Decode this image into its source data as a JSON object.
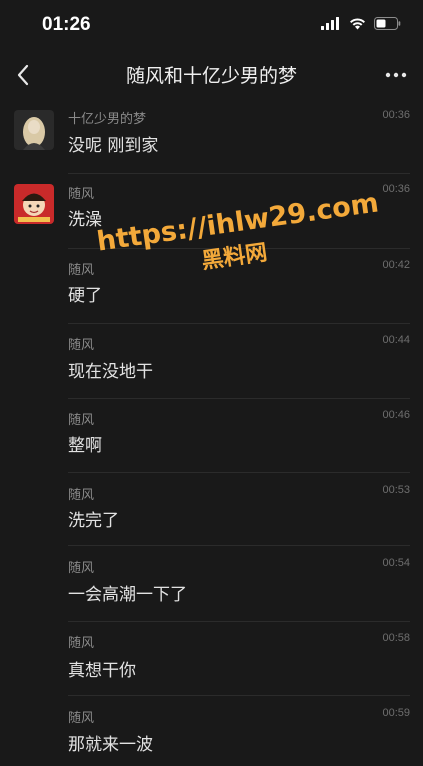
{
  "status_bar": {
    "time": "01:26"
  },
  "nav": {
    "title": "随风和十亿少男的梦",
    "back_icon": "chevron-left-icon",
    "more_icon": "ellipsis-icon"
  },
  "messages": [
    {
      "sender": "十亿少男的梦",
      "text": "没呢 刚到家",
      "time": "00:36",
      "avatar": "girl-avatar"
    },
    {
      "sender": "随风",
      "text": "洗澡",
      "time": "00:36",
      "avatar": "cartoon-avatar"
    },
    {
      "sender": "随风",
      "text": "硬了",
      "time": "00:42"
    },
    {
      "sender": "随风",
      "text": "现在没地干",
      "time": "00:44"
    },
    {
      "sender": "随风",
      "text": "整啊",
      "time": "00:46"
    },
    {
      "sender": "随风",
      "text": "洗完了",
      "time": "00:53"
    },
    {
      "sender": "随风",
      "text": "一会高潮一下了",
      "time": "00:54"
    },
    {
      "sender": "随风",
      "text": "真想干你",
      "time": "00:58"
    },
    {
      "sender": "随风",
      "text": "那就来一波",
      "time": "00:59"
    }
  ],
  "watermark": {
    "url": "https://ihlw29.com",
    "site": "黑料网"
  },
  "colors": {
    "background": "#191919",
    "watermark": "#f3a93a",
    "divider": "#2b2b2b"
  }
}
